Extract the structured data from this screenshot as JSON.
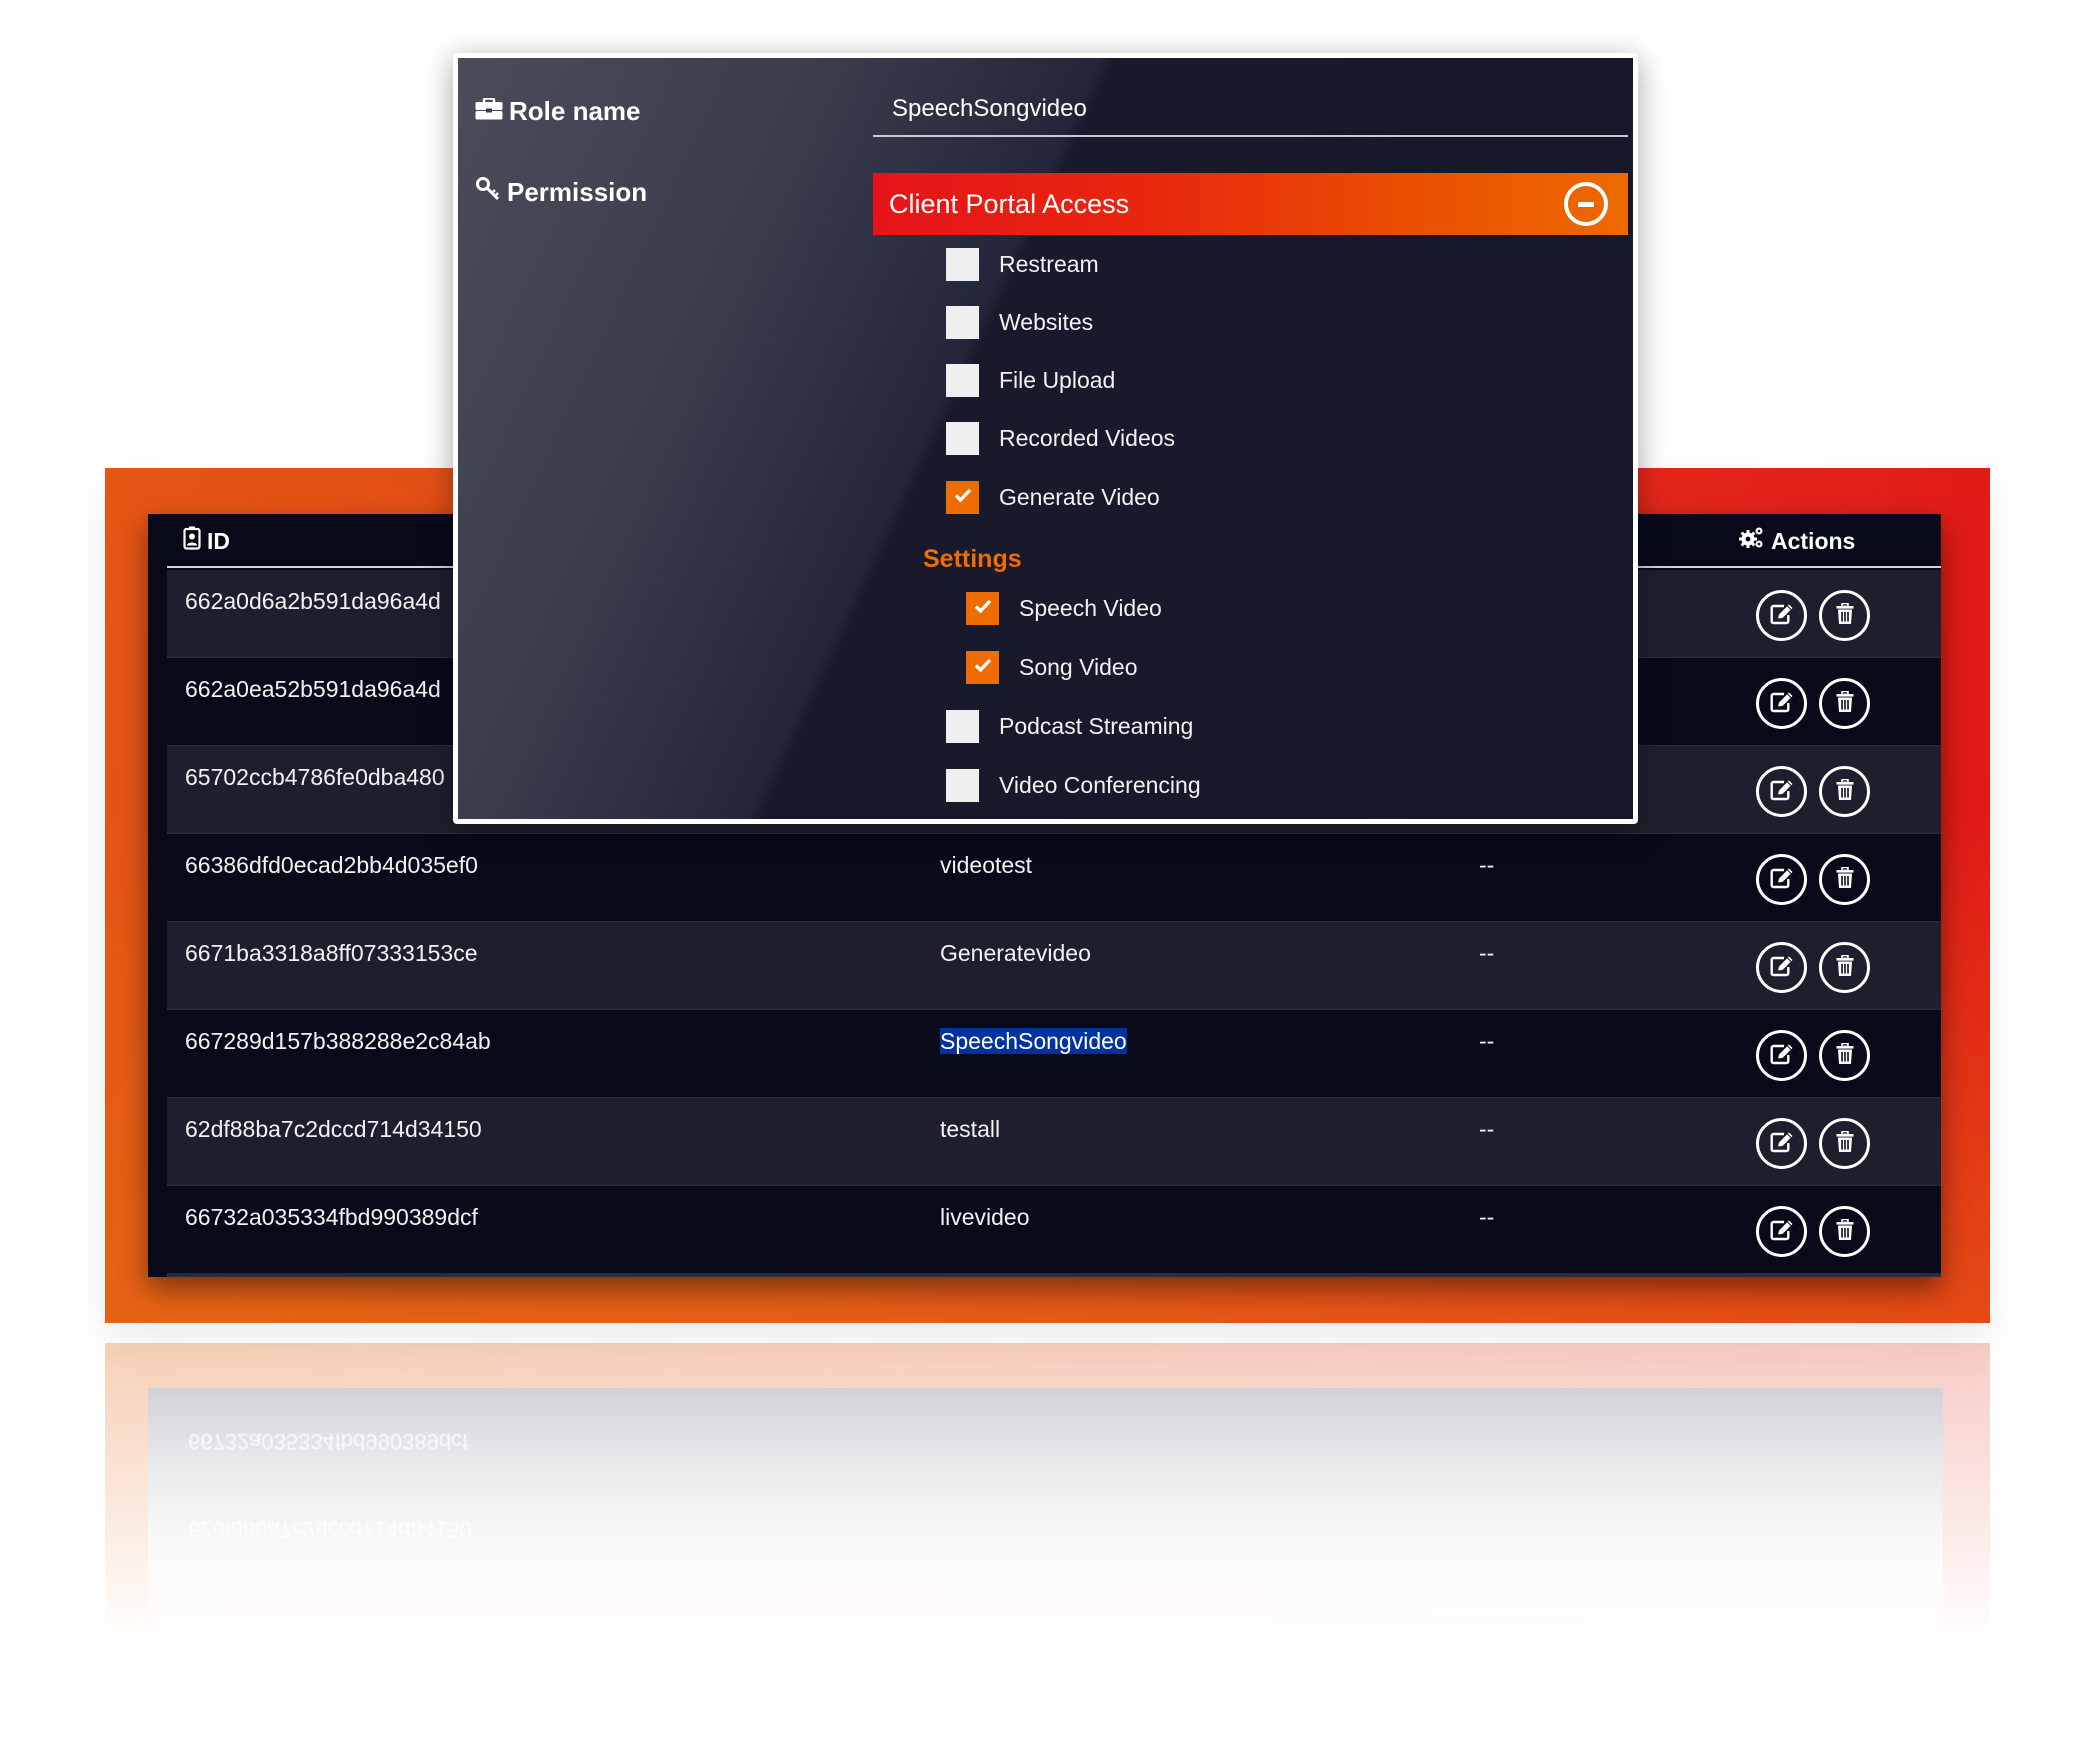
{
  "modal": {
    "role_name_label": "Role name",
    "role_name_icon": "briefcase-icon",
    "permission_label": "Permission",
    "permission_icon": "key-icon",
    "role_name_value": "SpeechSongvideo",
    "accordion": {
      "title": "Client Portal Access",
      "toggle_icon": "minus-circle-icon",
      "expanded": true
    },
    "permissions": [
      {
        "label": "Restream",
        "checked": false
      },
      {
        "label": "Websites",
        "checked": false
      },
      {
        "label": "File Upload",
        "checked": false
      },
      {
        "label": "Recorded Videos",
        "checked": false
      },
      {
        "label": "Generate Video",
        "checked": true
      }
    ],
    "settings": {
      "heading": "Settings",
      "items": [
        {
          "label": "Speech Video",
          "checked": true
        },
        {
          "label": "Song Video",
          "checked": true
        }
      ]
    },
    "more_permissions": [
      {
        "label": "Podcast Streaming",
        "checked": false
      },
      {
        "label": "Video Conferencing",
        "checked": false
      }
    ]
  },
  "table": {
    "headers": {
      "id": "ID",
      "id_icon": "id-badge-icon",
      "actions": "Actions",
      "actions_icon": "gears-icon"
    },
    "rows": [
      {
        "id": "662a0d6a2b591da96a4d",
        "name": "",
        "description": ""
      },
      {
        "id": "662a0ea52b591da96a4d",
        "name": "",
        "description": ""
      },
      {
        "id": "65702ccb4786fe0dba480",
        "name": "",
        "description": ""
      },
      {
        "id": "66386dfd0ecad2bb4d035ef0",
        "name": "videotest",
        "description": "--"
      },
      {
        "id": "6671ba3318a8ff07333153ce",
        "name": "Generatevideo",
        "description": "--"
      },
      {
        "id": "667289d157b388288e2c84ab",
        "name": "SpeechSongvideo",
        "description": "--",
        "selected": true
      },
      {
        "id": "62df88ba7c2dccd714d34150",
        "name": "testall",
        "description": "--"
      },
      {
        "id": "66732a035334fbd990389dcf",
        "name": "livevideo",
        "description": "--"
      }
    ],
    "row_actions": {
      "edit_icon": "edit-icon",
      "delete_icon": "trash-icon"
    }
  },
  "colors": {
    "accent_orange": "#ef6c00",
    "accent_red": "#e6141a",
    "selection_blue": "#0033a0",
    "table_bg": "#080a1a",
    "row_alt_bg": "#1e1f2e"
  }
}
